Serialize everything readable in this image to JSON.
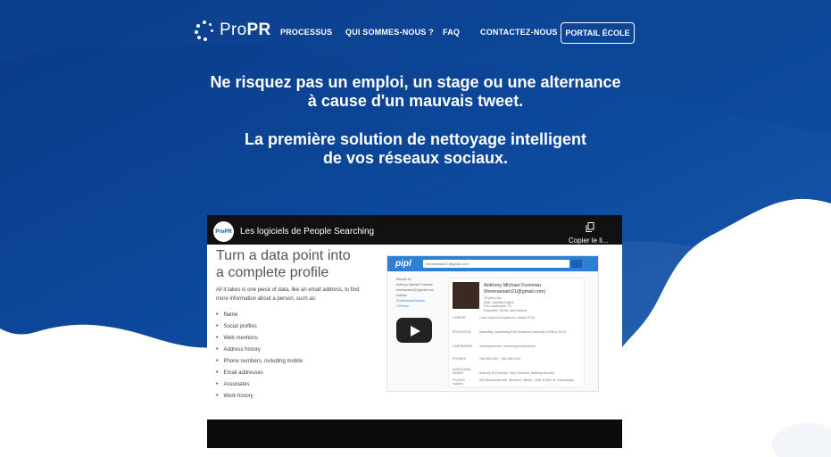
{
  "brand": {
    "logo_text_light": "Pro",
    "logo_text_bold": "PR"
  },
  "nav": {
    "items": [
      "PROCESSUS",
      "QUI SOMMES-NOUS ?",
      "FAQ",
      "CONTACTEZ-NOUS"
    ],
    "portal_button": "PORTAIL ÉCOLE"
  },
  "hero": {
    "line1": "Ne risquez pas un emploi, un stage ou une alternance",
    "line2": "à cause d'un mauvais tweet.",
    "line3": "La première solution de nettoyage intelligent",
    "line4": "de vos réseaux sociaux."
  },
  "video": {
    "channel_badge": "ProPR",
    "title": "Les logiciels de People Searching",
    "copy_label": "Copier le li...",
    "slide": {
      "title_line1": "Turn a data point into",
      "title_line2": "a complete profile",
      "intro": "All it takes is one piece of data, like an email address, to find more information about a person, such as:",
      "bullets": [
        "Name",
        "Social profiles",
        "Web mentions",
        "Address history",
        "Phone numbers, including mobile",
        "Email addresses",
        "Associates",
        "Work history"
      ]
    },
    "pipl": {
      "logo": "pipl",
      "search_value": "foremaniam21@gmail.com",
      "side_items": [
        "Results for",
        "Anthony Michael Foreman",
        "foremaniam21@gmail.com",
        "Indiana",
        "Professional Results",
        "1 Person"
      ],
      "profile_name": "Anthony Michael Foreman",
      "profile_email": "(foremaniam21@gmail.com)",
      "profile_meta": [
        "25 years old",
        "Male, Speaks English",
        "Fort Lauderdale, FL",
        "Evansville, Illinois, and Indiana"
      ],
      "rows": [
        {
          "label": "CAREER",
          "value": "Loss Control at Kaplan Inc. (since 2013)"
        },
        {
          "label": "EDUCATION",
          "value": "Marketing, Advertising Pub Relations University (2008 to 2012)"
        },
        {
          "label": "USERNAMES",
          "value": "anthonyforeman, theanonymousforeman"
        },
        {
          "label": "PHONES",
          "value": "786-555-4321 · 561-555-1947"
        },
        {
          "label": "ADDITIONAL NAMES",
          "value": "Anthony M Foreman, Tony Foreman, Anthony Michael"
        },
        {
          "label": "PLACES",
          "value": "308 Westmount Ave, Wheaton, Illinois · 1651 N 30th St, Indianapolis, Indiana"
        }
      ]
    }
  }
}
